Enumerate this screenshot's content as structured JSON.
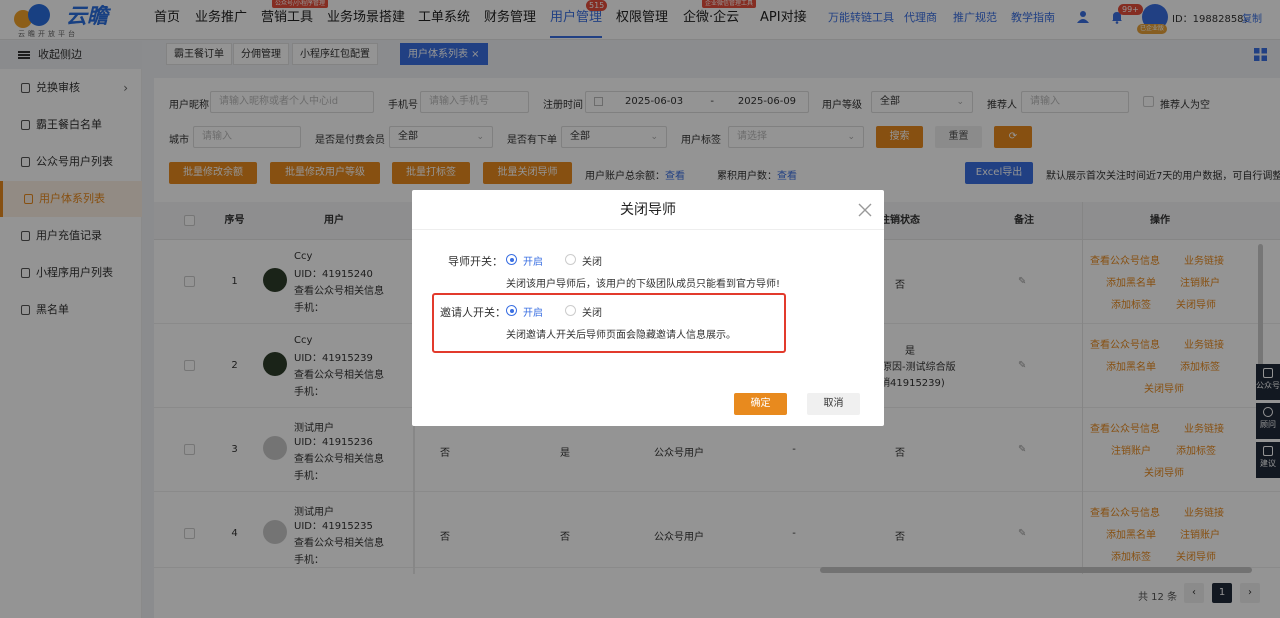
{
  "brand": {
    "name": "云瞻",
    "subtitle": "云瞻开放平台"
  },
  "nav": {
    "items": [
      "首页",
      "业务推广",
      "营销工具",
      "业务场景搭建",
      "工单系统",
      "财务管理",
      "用户管理",
      "权限管理",
      "企微·企云",
      "API对接"
    ],
    "active": "用户管理",
    "tag_marketing": "公众号/小程序管理",
    "tag_wecom": "企业微信管理工具",
    "badge_users": "515",
    "small_links": [
      "万能转链工具",
      "代理商",
      "推广规范",
      "教学指南"
    ]
  },
  "account": {
    "badge": "99+",
    "uid": "ID：19882858，",
    "copy": "复制",
    "avatar_tag": "已企业版"
  },
  "sidebar": {
    "collapse": "收起侧边",
    "items": [
      "兑换审核",
      "霸王餐白名单",
      "公众号用户列表",
      "用户体系列表",
      "用户充值记录",
      "小程序用户列表",
      "黑名单"
    ],
    "active": "用户体系列表"
  },
  "tabs": [
    "霸王餐订单",
    "分佣管理",
    "小程序红包配置",
    "用户体系列表 ×"
  ],
  "filters": {
    "nickname_label": "用户昵称",
    "nickname_ph": "请输入昵称或者个人中心id",
    "phone_label": "手机号",
    "phone_ph": "请输入手机号",
    "regtime_label": "注册时间",
    "date_start": "2025-06-03",
    "date_sep": "-",
    "date_end": "2025-06-09",
    "level_label": "用户等级",
    "level_val": "全部",
    "referrer_label": "推荐人",
    "referrer_ph": "请输入",
    "referrer_empty": "推荐人为空",
    "city_label": "城市",
    "city_ph": "请输入",
    "paid_label": "是否是付费会员",
    "paid_val": "全部",
    "order_label": "是否有下单",
    "order_val": "全部",
    "tag_label": "用户标签",
    "tag_ph": "请选择",
    "search_btn": "搜索",
    "reset_btn": "重置",
    "refresh_btn": "⟳"
  },
  "actions": {
    "batch_balance": "批量修改余额",
    "batch_level": "批量修改用户等级",
    "batch_tag": "批量打标签",
    "batch_mentor": "批量关闭导师",
    "balance_label": "用户账户总余额：",
    "view1": "查看",
    "users_label": "累积用户数：",
    "view2": "查看",
    "excel": "Excel导出",
    "note": "默认展示首次关注时间近7天的用户数据，可自行调整"
  },
  "table": {
    "headers": [
      "序号",
      "用户",
      "注销状态",
      "备注",
      "操作"
    ],
    "rows": [
      {
        "no": "1",
        "name": "Ccy",
        "uid": "UID：41915240",
        "link": "查看公众号相关信息",
        "phone": "手机：",
        "c1": "",
        "c2": "",
        "c3": "",
        "c4": "",
        "cancel": "否",
        "cancel2": "",
        "cancel3": "",
        "ops": [
          "查看公众号信息",
          "业务链接",
          "添加黑名单",
          "注销账户",
          "添加标签",
          "关闭导师"
        ],
        "dark": true
      },
      {
        "no": "2",
        "name": "Ccy",
        "uid": "UID：41915239",
        "link": "查看公众号相关信息",
        "phone": "手机：",
        "c1": "",
        "c2": "",
        "c3": "",
        "c4": "",
        "cancel": "是",
        "cancel2": "的原因-测试综合版",
        "cancel3": "销41915239)",
        "ops": [
          "查看公众号信息",
          "业务链接",
          "添加黑名单",
          "添加标签",
          "关闭导师"
        ],
        "dark": true
      },
      {
        "no": "3",
        "name": "测试用户",
        "uid": "UID：41915236",
        "link": "查看公众号相关信息",
        "phone": "手机：",
        "c1": "否",
        "c2": "是",
        "c3": "公众号用户",
        "c4": "-",
        "cancel": "否",
        "cancel2": "",
        "cancel3": "",
        "ops": [
          "查看公众号信息",
          "业务链接",
          "注销账户",
          "添加标签",
          "关闭导师"
        ],
        "dark": false
      },
      {
        "no": "4",
        "name": "测试用户",
        "uid": "UID：41915235",
        "link": "查看公众号相关信息",
        "phone": "手机：",
        "c1": "否",
        "c2": "否",
        "c3": "公众号用户",
        "c4": "-",
        "cancel": "否",
        "cancel2": "",
        "cancel3": "",
        "ops": [
          "查看公众号信息",
          "业务链接",
          "添加黑名单",
          "注销账户",
          "添加标签",
          "关闭导师"
        ],
        "dark": false
      }
    ]
  },
  "pager": {
    "total": "共 12 条",
    "prev": "‹",
    "current": "1",
    "next": "›"
  },
  "floats": [
    "公众号",
    "顾问",
    "建议"
  ],
  "modal": {
    "title": "关闭导师",
    "mentor_label": "导师开关：",
    "mentor_on": "开启",
    "mentor_off": "关闭",
    "mentor_desc": "关闭该用户导师后，该用户的下级团队成员只能看到官方导师!",
    "inviter_label": "邀请人开关：",
    "inviter_on": "开启",
    "inviter_off": "关闭",
    "inviter_desc": "关闭邀请人开关后导师页面会隐藏邀请人信息展示。",
    "ok": "确定",
    "cancel": "取消"
  },
  "colors": {
    "accent": "#3a6fe2",
    "orange": "#e88a1e",
    "highlight": "#e23a2c"
  }
}
